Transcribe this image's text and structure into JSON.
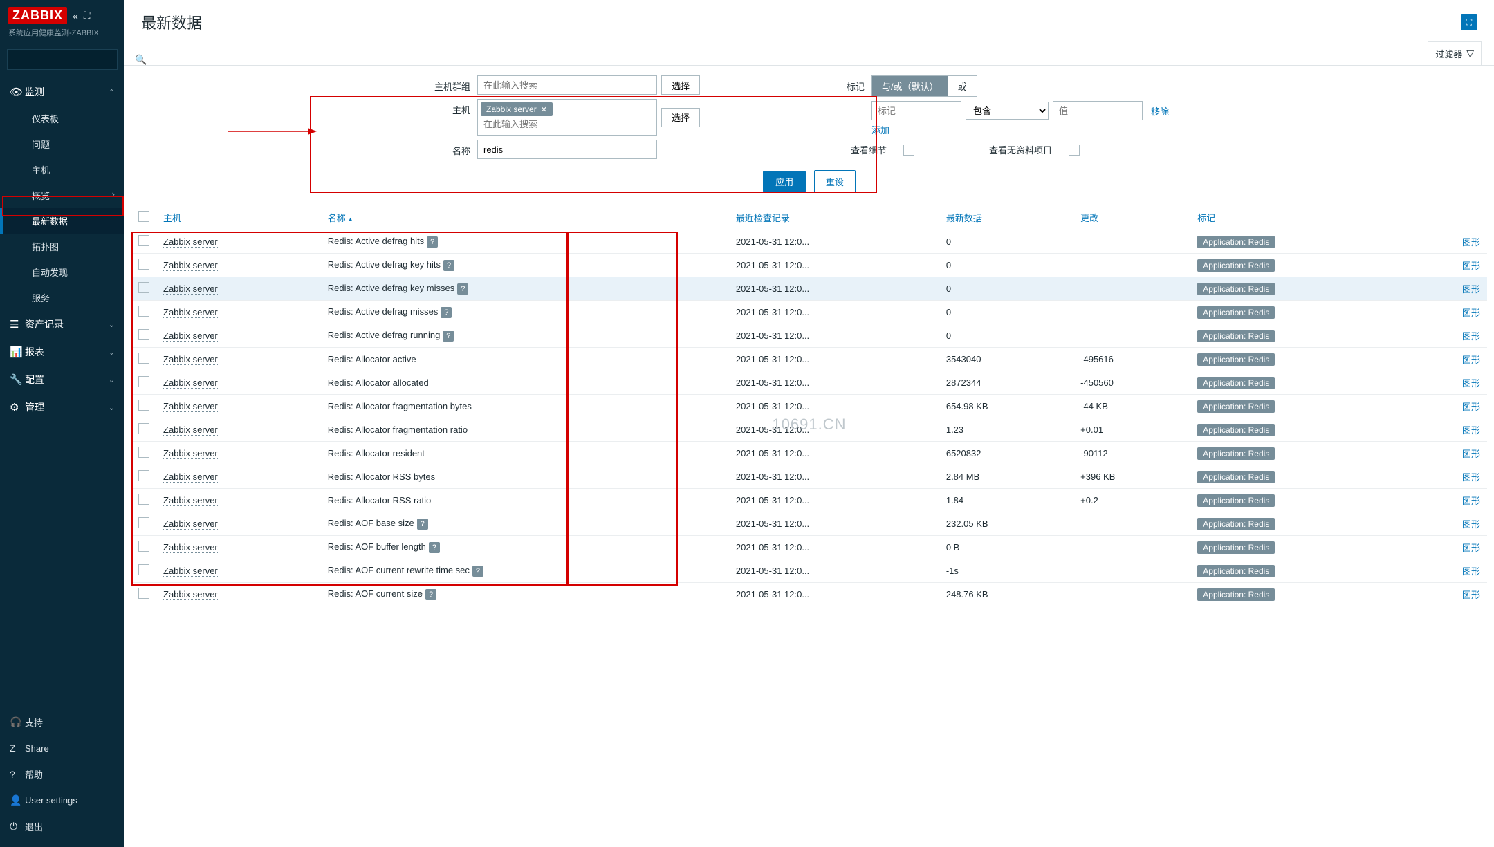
{
  "app": {
    "name": "ZABBIX",
    "subtitle": "系统应用健康监测-ZABBIX"
  },
  "sidebar": {
    "search_placeholder": "",
    "sections": {
      "monitor": {
        "label": "监测",
        "items": [
          "仪表板",
          "问题",
          "主机",
          "概览",
          "最新数据",
          "拓扑图",
          "自动发现",
          "服务"
        ]
      },
      "inventory": {
        "label": "资产记录"
      },
      "reports": {
        "label": "报表"
      },
      "config": {
        "label": "配置"
      },
      "admin": {
        "label": "管理"
      }
    },
    "footer": [
      "支持",
      "Share",
      "帮助",
      "User settings",
      "退出"
    ]
  },
  "page": {
    "title": "最新数据",
    "filter_tab": "过滤器"
  },
  "filter": {
    "labels": {
      "hostgroup": "主机群组",
      "host": "主机",
      "name": "名称",
      "tag": "标记",
      "detail": "查看细节",
      "noData": "查看无资料项目"
    },
    "placeholders": {
      "search": "在此输入搜索",
      "tag": "标记",
      "value": "值"
    },
    "host_chip": "Zabbix server",
    "name_value": "redis",
    "select_btn": "选择",
    "tag_mode": {
      "andor": "与/或（默认）",
      "or": "或"
    },
    "op_select": "包含",
    "remove": "移除",
    "add": "添加",
    "apply": "应用",
    "reset": "重设"
  },
  "table": {
    "headers": {
      "host": "主机",
      "name": "名称",
      "lastcheck": "最近检查记录",
      "lastdata": "最新数据",
      "change": "更改",
      "tags": "标记",
      "graph": "图形"
    },
    "app_tag": "Application: Redis",
    "rows": [
      {
        "host": "Zabbix server",
        "name": "Redis: Active defrag hits",
        "q": true,
        "time": "2021-05-31 12:0...",
        "data": "0",
        "change": "",
        "hover": false
      },
      {
        "host": "Zabbix server",
        "name": "Redis: Active defrag key hits",
        "q": true,
        "time": "2021-05-31 12:0...",
        "data": "0",
        "change": "",
        "hover": false
      },
      {
        "host": "Zabbix server",
        "name": "Redis: Active defrag key misses",
        "q": true,
        "time": "2021-05-31 12:0...",
        "data": "0",
        "change": "",
        "hover": true
      },
      {
        "host": "Zabbix server",
        "name": "Redis: Active defrag misses",
        "q": true,
        "time": "2021-05-31 12:0...",
        "data": "0",
        "change": "",
        "hover": false
      },
      {
        "host": "Zabbix server",
        "name": "Redis: Active defrag running",
        "q": true,
        "time": "2021-05-31 12:0...",
        "data": "0",
        "change": "",
        "hover": false
      },
      {
        "host": "Zabbix server",
        "name": "Redis: Allocator active",
        "q": false,
        "time": "2021-05-31 12:0...",
        "data": "3543040",
        "change": "-495616",
        "hover": false
      },
      {
        "host": "Zabbix server",
        "name": "Redis: Allocator allocated",
        "q": false,
        "time": "2021-05-31 12:0...",
        "data": "2872344",
        "change": "-450560",
        "hover": false
      },
      {
        "host": "Zabbix server",
        "name": "Redis: Allocator fragmentation bytes",
        "q": false,
        "time": "2021-05-31 12:0...",
        "data": "654.98 KB",
        "change": "-44 KB",
        "hover": false
      },
      {
        "host": "Zabbix server",
        "name": "Redis: Allocator fragmentation ratio",
        "q": false,
        "time": "2021-05-31 12:0...",
        "data": "1.23",
        "change": "+0.01",
        "hover": false
      },
      {
        "host": "Zabbix server",
        "name": "Redis: Allocator resident",
        "q": false,
        "time": "2021-05-31 12:0...",
        "data": "6520832",
        "change": "-90112",
        "hover": false
      },
      {
        "host": "Zabbix server",
        "name": "Redis: Allocator RSS bytes",
        "q": false,
        "time": "2021-05-31 12:0...",
        "data": "2.84 MB",
        "change": "+396 KB",
        "hover": false
      },
      {
        "host": "Zabbix server",
        "name": "Redis: Allocator RSS ratio",
        "q": false,
        "time": "2021-05-31 12:0...",
        "data": "1.84",
        "change": "+0.2",
        "hover": false
      },
      {
        "host": "Zabbix server",
        "name": "Redis: AOF base size",
        "q": true,
        "time": "2021-05-31 12:0...",
        "data": "232.05 KB",
        "change": "",
        "hover": false
      },
      {
        "host": "Zabbix server",
        "name": "Redis: AOF buffer length",
        "q": true,
        "time": "2021-05-31 12:0...",
        "data": "0 B",
        "change": "",
        "hover": false
      },
      {
        "host": "Zabbix server",
        "name": "Redis: AOF current rewrite time sec",
        "q": true,
        "time": "2021-05-31 12:0...",
        "data": "-1s",
        "change": "",
        "hover": false
      },
      {
        "host": "Zabbix server",
        "name": "Redis: AOF current size",
        "q": true,
        "time": "2021-05-31 12:0...",
        "data": "248.76 KB",
        "change": "",
        "hover": false
      }
    ]
  },
  "watermark": "10691.CN"
}
